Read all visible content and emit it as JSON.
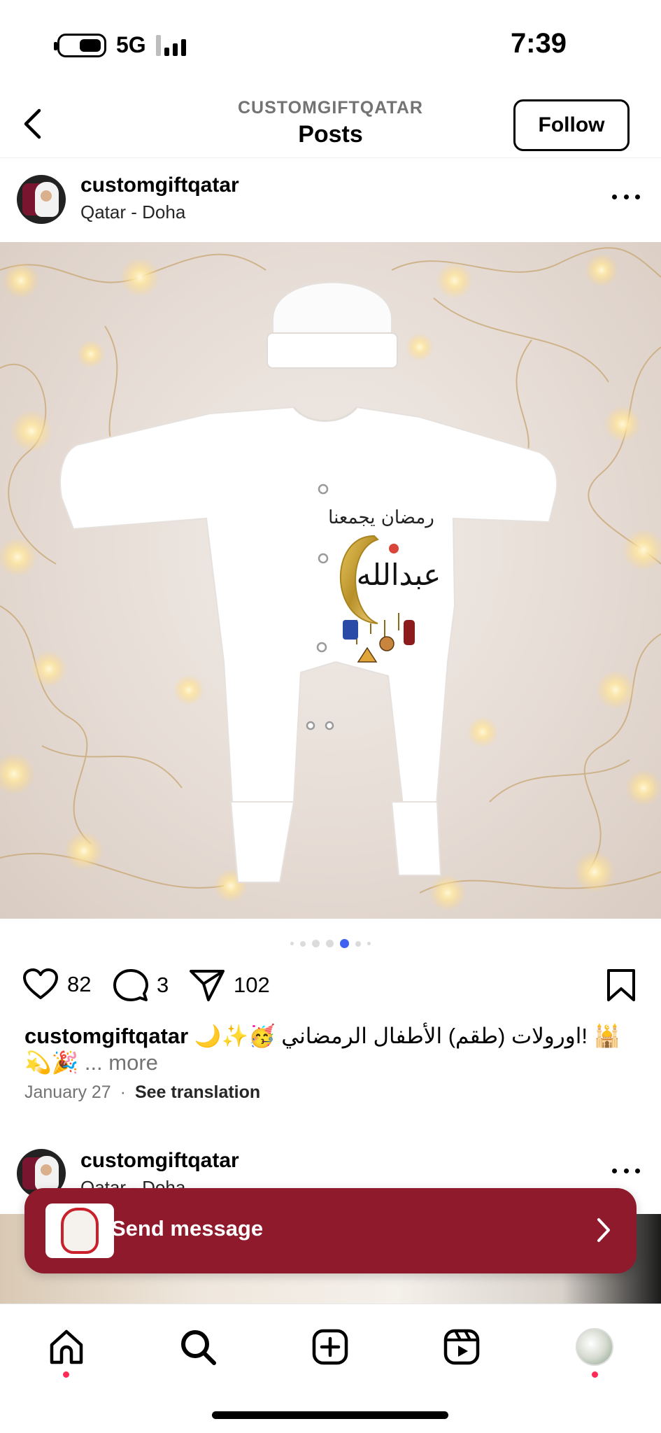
{
  "status_bar": {
    "network": "5G",
    "time": "7:39"
  },
  "header": {
    "account": "CUSTOMGIFTQATAR",
    "title": "Posts",
    "follow_label": "Follow"
  },
  "post": {
    "username": "customgiftqatar",
    "location": "Qatar - Doha",
    "image_text": {
      "top_line": "رمضان يجمعنا",
      "name": "عبدالله"
    },
    "carousel": {
      "total": 7,
      "active_index": 4
    },
    "likes": "82",
    "comments": "3",
    "shares": "102",
    "caption_user": "customgiftqatar",
    "caption_text": " 🌙✨🥳 اورولات (طقم) الأطفال الرمضاني! 🕌",
    "caption_text2": "💫🎉",
    "caption_more": "... more",
    "date": "January 27",
    "separator": "·",
    "see_translation": "See translation"
  },
  "next_post": {
    "username": "customgiftqatar",
    "location": "Qatar - Doha"
  },
  "send_message": {
    "label": "Send message"
  },
  "colors": {
    "banner": "#8f1a2b",
    "active_dot": "#3f62f1",
    "notification_dot": "#ff2a55"
  },
  "tabbar": {
    "icons": [
      "home-icon",
      "search-icon",
      "create-icon",
      "reels-icon",
      "profile-icon"
    ]
  }
}
